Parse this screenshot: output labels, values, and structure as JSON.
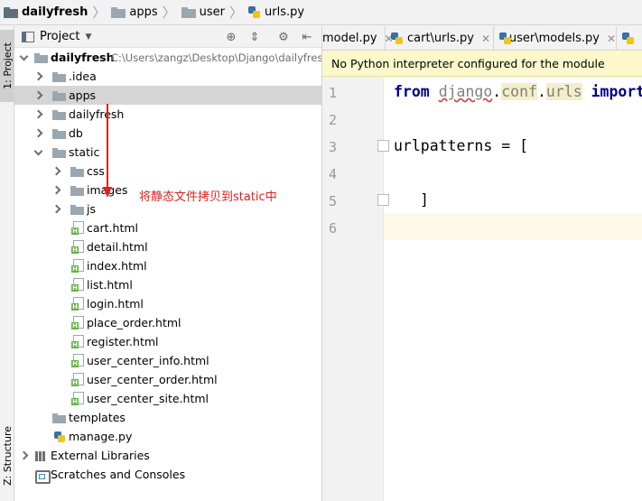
{
  "breadcrumb": {
    "project": "dailyfresh",
    "folder1": "apps",
    "folder2": "user",
    "file": "urls.py"
  },
  "tool_strip": {
    "project_tab": "1: Project",
    "structure_tab": "Z: Structure"
  },
  "project_panel": {
    "title": "Project",
    "root_name": "dailyfresh",
    "root_path": "C:\\Users\\zangz\\Desktop\\Django\\dailyfresh"
  },
  "tree": {
    "idea": ".idea",
    "apps": "apps",
    "dailyfresh": "dailyfresh",
    "db": "db",
    "static": "static",
    "css": "css",
    "images": "images",
    "js": "js",
    "files": [
      "cart.html",
      "detail.html",
      "index.html",
      "list.html",
      "login.html",
      "place_order.html",
      "register.html",
      "user_center_info.html",
      "user_center_order.html",
      "user_center_site.html"
    ],
    "templates": "templates",
    "manage": "manage.py",
    "external_libraries": "External Libraries",
    "scratches": "Scratches and Consoles"
  },
  "annotation": {
    "text": "将静态文件拷贝到static中",
    "color": "#e02020"
  },
  "tabs": [
    {
      "label": "model.py"
    },
    {
      "label": "cart\\urls.py"
    },
    {
      "label": "user\\models.py"
    }
  ],
  "banner": {
    "message": "No Python interpreter configured for the module"
  },
  "editor": {
    "line_numbers": [
      "1",
      "2",
      "3",
      "4",
      "5",
      "6"
    ],
    "line1": {
      "kw_from": "from",
      "mod1": "django",
      "dot1": ".",
      "mod2": "conf",
      "dot2": ".",
      "mod3": "urls",
      "kw_import": "import"
    },
    "line3": "urlpatterns = [",
    "line5": "]"
  },
  "colors": {
    "banner_bg": "#fdf8c9",
    "keyword": "#000080",
    "selected_row": "#d5d5d5"
  }
}
